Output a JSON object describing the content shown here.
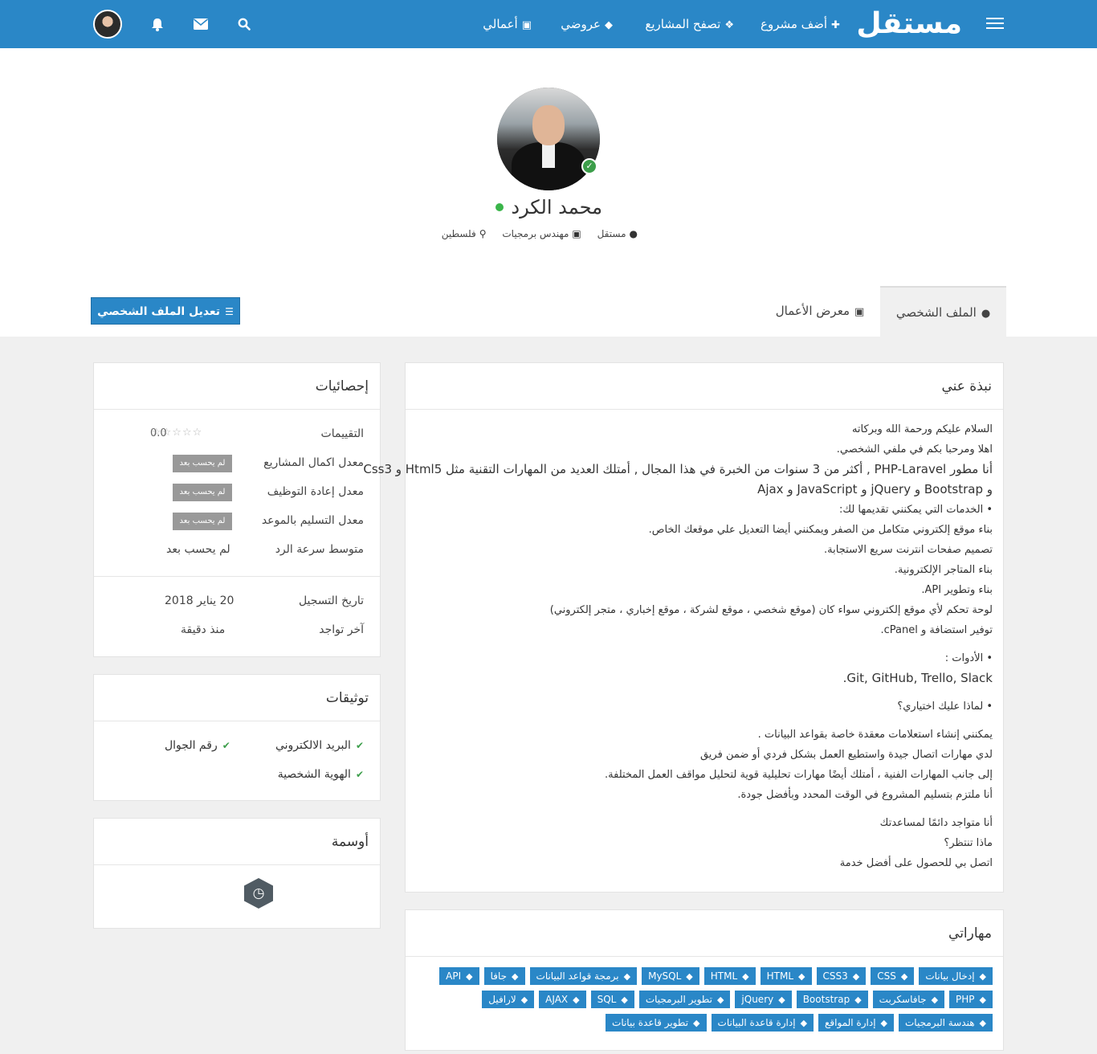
{
  "topbar": {
    "logo": "مستقل",
    "nav": [
      {
        "icon": "plus-icon",
        "label": "أضف مشروع"
      },
      {
        "icon": "cubes-icon",
        "label": "تصفح المشاريع"
      },
      {
        "icon": "tag-icon",
        "label": "عروضي"
      },
      {
        "icon": "briefcase-icon",
        "label": "أعمالي"
      }
    ],
    "icons": [
      "search-icon",
      "envelope-icon",
      "bell-icon",
      "user-avatar"
    ]
  },
  "profile": {
    "name": "محمد الكرد",
    "meta": {
      "site": "مستقل",
      "job": "مهندس برمجيات",
      "country": "فلسطين"
    }
  },
  "tabs": {
    "profile": "الملف الشخصي",
    "portfolio": "معرض الأعمال",
    "edit_button": "تعديل الملف الشخصي"
  },
  "stats": {
    "title": "إحصائيات",
    "ratings_label": "التقييمات",
    "ratings_value": "0.0",
    "completion_label": "معدل اكمال المشاريع",
    "rehire_label": "معدل إعادة التوظيف",
    "ontime_label": "معدل التسليم بالموعد",
    "not_calculated_badge": "لم يحسب بعد",
    "response_label": "متوسط سرعة الرد",
    "response_value": "لم يحسب بعد",
    "registration_label": "تاريخ التسجيل",
    "registration_value": "20 يناير 2018",
    "last_seen_label": "آخر تواجد",
    "last_seen_value": "منذ دقيقة"
  },
  "verifications": {
    "title": "توثيقات",
    "email": "البريد الالكتروني",
    "phone": "رقم الجوال",
    "identity": "الهوية الشخصية"
  },
  "badges": {
    "title": "أوسمة"
  },
  "about": {
    "title": "نبذة عني",
    "lines": [
      "السلام عليكم ورحمة الله وبركاته",
      "اهلا ومرحبا بكم في ملفي الشخصي.",
      "أنا مطور PHP-Laravel , أكثر من 3 سنوات من الخبرة في هذا المجال , أمتلك العديد من المهارات التقنية مثل Html5 و Css3",
      "و Bootstrap و jQuery و JavaScript و Ajax",
      "• الخدمات التي يمكنني تقديمها لك:",
      "بناء موقع إلكتروني متكامل من الصفر ويمكنني أيضا التعديل علي موقعك الخاص.",
      "تصميم صفحات انترنت سريع الاستجابة.",
      "بناء المتاجر الإلكترونية.",
      "بناء وتطوير API.",
      "لوحة تحكم لأي موقع إلكتروني سواء كان (موقع شخصي ، موقع لشركة ، موقع إخباري ، متجر إلكتروني)",
      "توفير استضافة و cPanel.",
      "• الأدوات :",
      "Git, GitHub, Trello, Slack.",
      "• لماذا عليك اختياري؟",
      "يمكنني إنشاء استعلامات معقدة خاصة بقواعد البيانات .",
      "لدي مهارات اتصال جيدة واستطيع العمل بشكل فردي أو ضمن فريق",
      "إلى جانب المهارات الفنية ، أمتلك أيضًا مهارات تحليلية قوية لتحليل مواقف العمل المختلفة.",
      "أنا ملتزم بتسليم المشروع في الوقت المحدد وبأفضل جودة.",
      "أنا متواجد دائمًا لمساعدتك",
      "ماذا تنتظر؟",
      "اتصل بي للحصول على أفضل خدمة"
    ]
  },
  "skills": {
    "title": "مهاراتي",
    "rows": [
      [
        "إدخال بيانات",
        "CSS",
        "CSS3",
        "HTML",
        "HTML",
        "MySQL",
        "برمجة قواعد البيانات",
        "جافا",
        "API"
      ],
      [
        "PHP",
        "جافاسكربت",
        "Bootstrap",
        "jQuery",
        "تطوير البرمجيات",
        "SQL",
        "AJAX",
        "لارافيل"
      ],
      [
        "هندسة البرمجيات",
        "إدارة المواقع",
        "إدارة قاعدة البيانات",
        "تطوير قاعدة بيانات"
      ]
    ]
  }
}
